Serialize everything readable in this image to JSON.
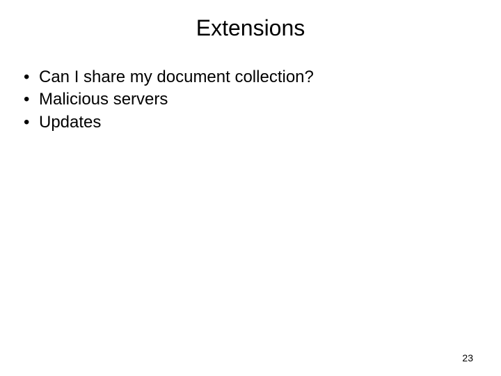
{
  "slide": {
    "title": "Extensions",
    "bullets": [
      "Can I share my document collection?",
      "Malicious servers",
      "Updates"
    ],
    "page_number": "23"
  }
}
